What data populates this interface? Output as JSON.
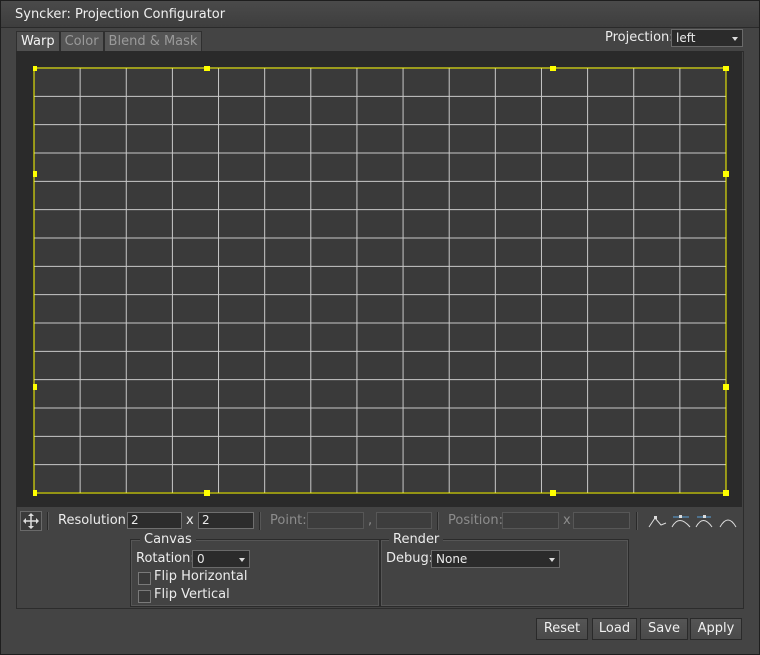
{
  "window": {
    "title": "Syncker: Projection Configurator"
  },
  "tabs": [
    {
      "label": "Warp",
      "active": true
    },
    {
      "label": "Color",
      "active": false
    },
    {
      "label": "Blend & Mask",
      "active": false
    }
  ],
  "projection": {
    "label": "Projection:",
    "value": "left"
  },
  "toolbar": {
    "move_icon": "move-arrows-icon",
    "resolution_label": "Resolution:",
    "resolution_x": "2",
    "resolution_sep": "x",
    "resolution_y": "2",
    "point_label": "Point:",
    "point_sep": ",",
    "position_label": "Position:",
    "position_sep": "x",
    "curve_icons": [
      "linear-curve-icon",
      "bezier-curve-icon",
      "bezier-handles-icon",
      "arc-curve-icon"
    ]
  },
  "canvas_group": {
    "title": "Canvas",
    "rotation_label": "Rotation:",
    "rotation_value": "0",
    "flip_horizontal": "Flip Horizontal",
    "flip_vertical": "Flip Vertical"
  },
  "render_group": {
    "title": "Render",
    "debug_label": "Debug:",
    "debug_value": "None"
  },
  "buttons": {
    "reset": "Reset",
    "load": "Load",
    "save": "Save",
    "apply": "Apply"
  },
  "colors": {
    "grid_line": "#c8c8c8",
    "warp_border": "#ffff00",
    "handle": "#ffff00",
    "canvas_bg": "#3a3a3a"
  }
}
